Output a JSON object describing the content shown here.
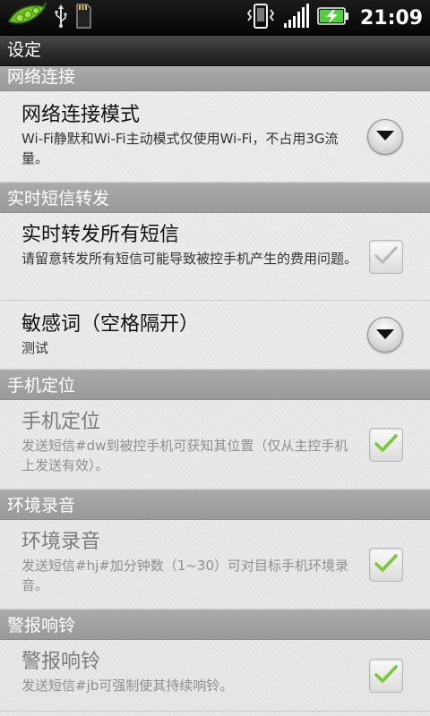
{
  "status_bar": {
    "time": "21:09",
    "icons": [
      "pea-pod-app-icon",
      "usb-icon",
      "sd-card-icon",
      "phone-vibrate-icon",
      "signal-icon",
      "battery-charging-icon"
    ]
  },
  "title_bar": {
    "title": "设定"
  },
  "sections": {
    "network": {
      "header": "网络连接",
      "mode": {
        "title": "网络连接模式",
        "summary": "Wi-Fi静默和Wi-Fi主动模式仅使用Wi-Fi，不占用3G流量。"
      }
    },
    "sms_forward": {
      "header": "实时短信转发",
      "forward_all": {
        "title": "实时转发所有短信",
        "summary": "请留意转发所有短信可能导致被控手机产生的费用问题。",
        "checked": true,
        "enabled": true
      },
      "keywords": {
        "title": "敏感词（空格隔开）",
        "summary": "测试"
      }
    },
    "location": {
      "header": "手机定位",
      "locate": {
        "title": "手机定位",
        "summary": "发送短信#dw到被控手机可获知其位置（仅从主控手机上发送有效）。",
        "checked": true,
        "enabled": false
      }
    },
    "recording": {
      "header": "环境录音",
      "record": {
        "title": "环境录音",
        "summary": "发送短信#hj#加分钟数（1~30）可对目标手机环境录音。",
        "checked": true,
        "enabled": false
      }
    },
    "alarm": {
      "header": "警报响铃",
      "ring": {
        "title": "警报响铃",
        "summary": "发送短信#jb可强制使其持续响铃。",
        "checked": true,
        "enabled": false
      }
    }
  },
  "colors": {
    "section_header": "#a3a3a3",
    "check_enabled": "#b9b9b9",
    "check_disabled": "#7cc73c",
    "battery": "#4fd13a"
  }
}
